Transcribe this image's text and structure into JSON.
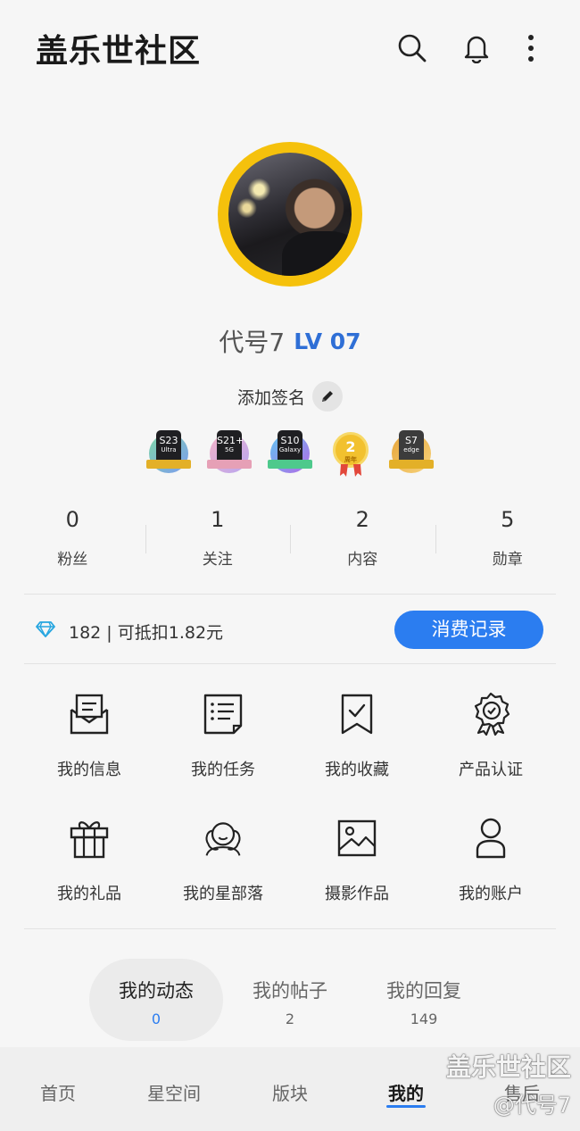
{
  "header": {
    "title": "盖乐世社区",
    "icons": [
      "search-icon",
      "bell-icon",
      "more-vertical-icon"
    ]
  },
  "profile": {
    "username": "代号7",
    "level": "LV 07",
    "signature": "添加签名",
    "badges": [
      {
        "model": "S23",
        "sub": "Ultra",
        "colors": [
          "#7fd6a8",
          "#7c9cf0"
        ]
      },
      {
        "model": "S21+",
        "sub": "5G",
        "colors": [
          "#f5b3c8",
          "#b8a6f0"
        ]
      },
      {
        "model": "S10",
        "sub": "Galaxy",
        "colors": [
          "#60c4f0",
          "#b26ae8"
        ]
      },
      {
        "model": "2",
        "sub": "周年",
        "colors": [
          "#f2c12e",
          "#e2473a"
        ]
      },
      {
        "model": "S7",
        "sub": "edge",
        "colors": [
          "#e8a53a",
          "#3c3c3c"
        ]
      }
    ]
  },
  "stats": [
    {
      "value": "0",
      "label": "粉丝"
    },
    {
      "value": "1",
      "label": "关注"
    },
    {
      "value": "2",
      "label": "内容"
    },
    {
      "value": "5",
      "label": "勋章"
    }
  ],
  "points": {
    "text": "182 | 可抵扣1.82元",
    "button": "消费记录"
  },
  "menu": [
    {
      "label": "我的信息",
      "icon": "message-icon"
    },
    {
      "label": "我的任务",
      "icon": "task-list-icon"
    },
    {
      "label": "我的收藏",
      "icon": "bookmark-icon"
    },
    {
      "label": "产品认证",
      "icon": "certificate-icon"
    },
    {
      "label": "我的礼品",
      "icon": "gift-icon"
    },
    {
      "label": "我的星部落",
      "icon": "tribe-icon"
    },
    {
      "label": "摄影作品",
      "icon": "image-icon"
    },
    {
      "label": "我的账户",
      "icon": "user-icon"
    }
  ],
  "tabs": [
    {
      "label": "我的动态",
      "count": "0"
    },
    {
      "label": "我的帖子",
      "count": "2"
    },
    {
      "label": "我的回复",
      "count": "149"
    }
  ],
  "bottom_nav": [
    {
      "label": "首页"
    },
    {
      "label": "星空间"
    },
    {
      "label": "版块"
    },
    {
      "label": "我的"
    },
    {
      "label": "售后"
    }
  ],
  "watermark": {
    "line1": "盖乐世社区",
    "line2": "@代号7"
  },
  "colors": {
    "accent": "#2b7df0",
    "level": "#2f6fd6",
    "avatar_ring": "#f5c10c"
  }
}
